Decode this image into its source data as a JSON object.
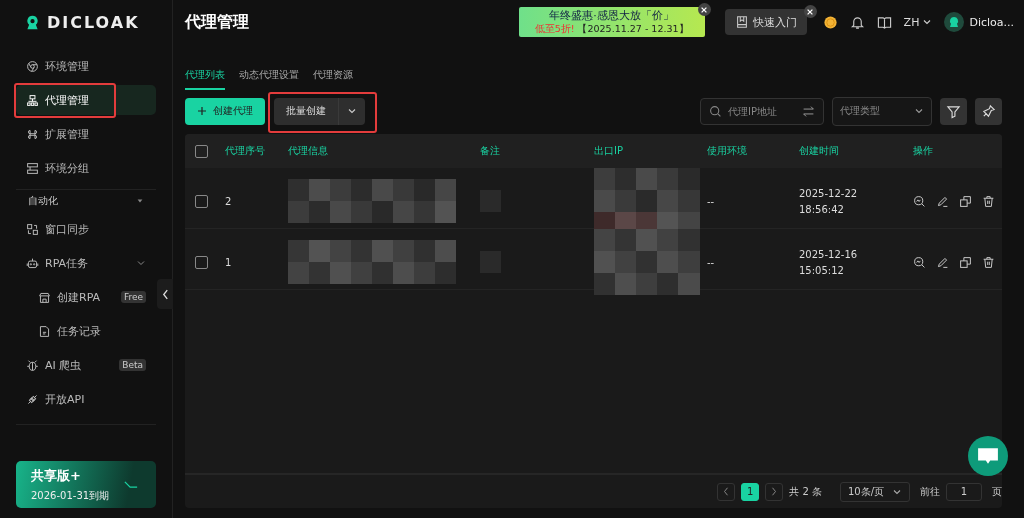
{
  "logo": {
    "text": "DICLOAK"
  },
  "sidebar": {
    "items": [
      {
        "kind": "item",
        "label": "环境管理",
        "selected": false
      },
      {
        "kind": "item",
        "label": "代理管理",
        "selected": true
      },
      {
        "kind": "item",
        "label": "扩展管理",
        "selected": false
      },
      {
        "kind": "item",
        "label": "环境分组",
        "selected": false
      },
      {
        "kind": "section",
        "label": "自动化",
        "expanded": true
      },
      {
        "kind": "item",
        "label": "窗口同步",
        "selected": false
      },
      {
        "kind": "group",
        "label": "RPA任务",
        "expanded": true,
        "selected": false,
        "children": [
          {
            "kind": "sub",
            "label": "创建RPA",
            "badge": "Free",
            "selected": false
          },
          {
            "kind": "sub",
            "label": "任务记录",
            "selected": false
          }
        ]
      },
      {
        "kind": "item",
        "label": "AI 爬虫",
        "badge": "Beta",
        "selected": false
      },
      {
        "kind": "item",
        "label": "开放API",
        "selected": false
      }
    ],
    "plan": {
      "name": "共享版+",
      "expiry": "2026-01-31到期"
    }
  },
  "header": {
    "title": "代理管理",
    "promo": {
      "title": "年终盛惠·感恩大放「价」",
      "discount": "低至5折!",
      "dates": "【2025.11.27 - 12.31】"
    },
    "quick_start": "快速入门",
    "language": "ZH",
    "user": "Dicloa..."
  },
  "tabs": [
    {
      "label": "代理列表",
      "selected": true
    },
    {
      "label": "动态代理设置",
      "selected": false
    },
    {
      "label": "代理资源",
      "selected": false
    }
  ],
  "toolbar": {
    "create": "创建代理",
    "batch": "批量创建",
    "search_placeholder": "代理IP地址",
    "type_placeholder": "代理类型"
  },
  "table": {
    "all_checked": false,
    "columns": [
      "代理序号",
      "代理信息",
      "备注",
      "出口IP",
      "使用环境",
      "创建时间",
      "操作"
    ],
    "rows": [
      {
        "checked": false,
        "index": "2",
        "environment": "--",
        "date": "2025-12-22",
        "time": "18:56:42"
      },
      {
        "checked": false,
        "index": "1",
        "environment": "--",
        "date": "2025-12-16",
        "time": "15:05:12"
      }
    ]
  },
  "pagination": {
    "pages": [
      {
        "label": "1",
        "selected": true
      }
    ],
    "total": "共 2 条",
    "page_size": "10条/页",
    "goto_label": "前往",
    "goto_value": "1",
    "goto_suffix": "页"
  }
}
